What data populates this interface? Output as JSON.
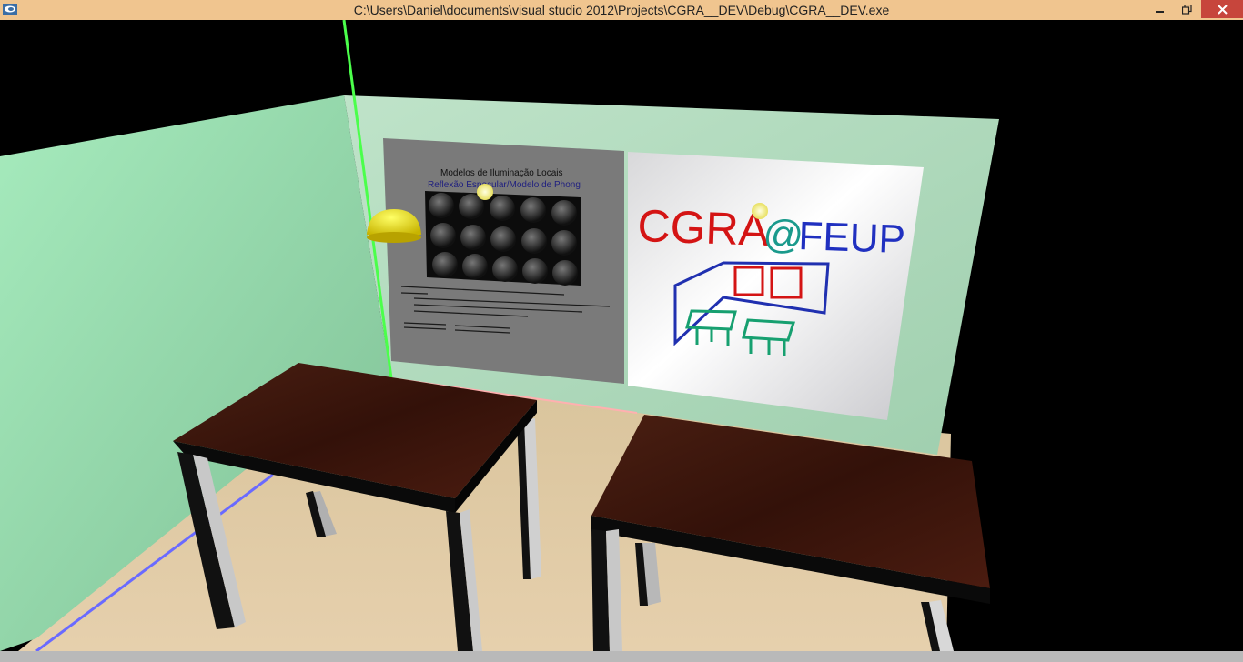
{
  "window": {
    "title": "C:\\Users\\Daniel\\documents\\visual studio 2012\\Projects\\CGRA__DEV\\Debug\\CGRA__DEV.exe",
    "icon": "app-icon",
    "controls": {
      "minimize": "minimize-icon",
      "maximize": "restore-icon",
      "close": "close-icon"
    }
  },
  "scene": {
    "left_slide": {
      "title": "Modelos de Iluminação Locais",
      "subtitle": "Reflexão Especular/Modelo de Phong"
    },
    "whiteboard": {
      "text_cgra": "CGRA",
      "text_at": "@",
      "text_feup": "FEUP"
    }
  },
  "colors": {
    "titlebar": "#f0c58f",
    "wall_side": "#8fd9ab",
    "wall_back": "#a8d8b6",
    "floor": "#e3c9a3",
    "table_top": "#3d160e",
    "lamp": "#e8d400"
  }
}
